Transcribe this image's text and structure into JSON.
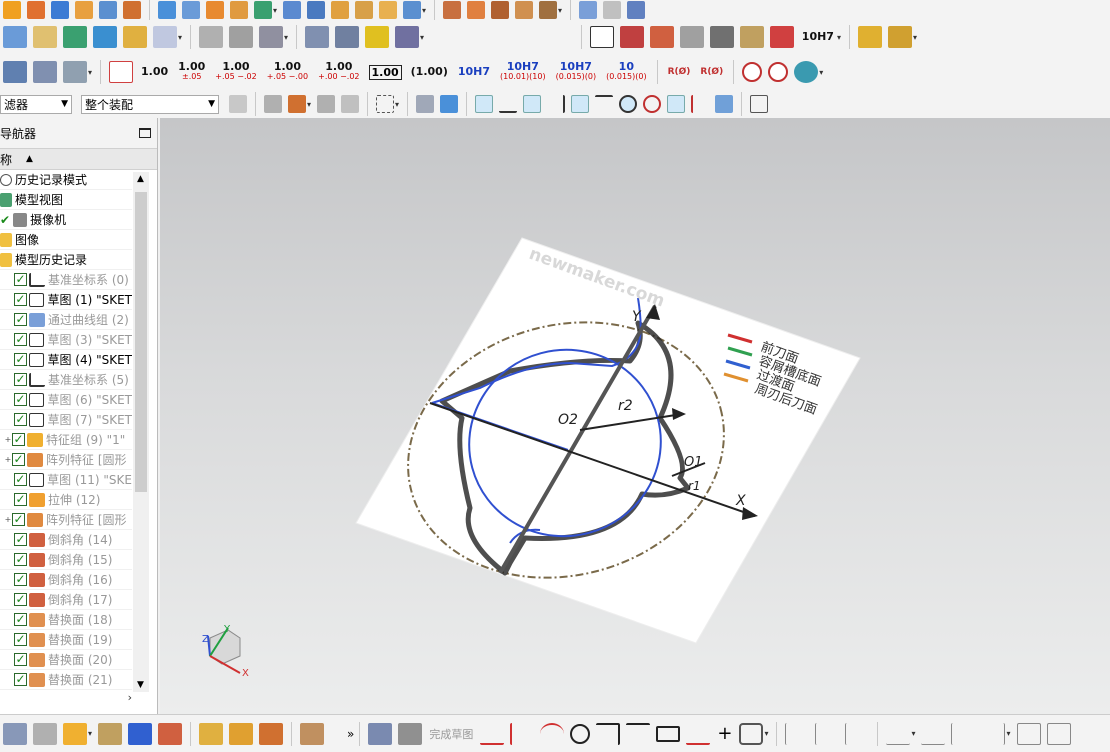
{
  "toolbar": {
    "dims": [
      {
        "main": "1.00",
        "sub": ""
      },
      {
        "main": "1.00",
        "sub": "±.05"
      },
      {
        "main": "1.00",
        "sub": "+.05 −.02"
      },
      {
        "main": "1.00",
        "sub": "+.05 −.00"
      },
      {
        "main": "1.00",
        "sub": "+.00 −.02"
      }
    ],
    "boxed_dim": "1.00",
    "paren_dim": "(1.00)",
    "fits": [
      "10H7",
      "10H7",
      "10H7",
      "10"
    ],
    "fit_subs": [
      "(10.01)(10)",
      "(0.015)(0)",
      "(0.015)(0)"
    ],
    "fit_label": "10H7",
    "radius_labels": [
      "R(Ø)",
      "R(Ø)"
    ]
  },
  "filters": {
    "select_filter": "滤器",
    "assembly_scope": "整个装配"
  },
  "navigator": {
    "title": "导航器",
    "column_name": "称",
    "items": [
      {
        "label": "历史记录模式",
        "grey": false
      },
      {
        "label": "模型视图",
        "grey": false
      },
      {
        "label": "摄像机",
        "grey": false
      },
      {
        "label": "图像",
        "grey": false
      },
      {
        "label": "模型历史记录",
        "grey": false
      },
      {
        "label": "基准坐标系 (0)",
        "grey": true
      },
      {
        "label": "草图 (1) \"SKET",
        "grey": false
      },
      {
        "label": "通过曲线组 (2)",
        "grey": true
      },
      {
        "label": "草图 (3) \"SKET",
        "grey": true
      },
      {
        "label": "草图 (4) \"SKET",
        "grey": false
      },
      {
        "label": "基准坐标系 (5)",
        "grey": true
      },
      {
        "label": "草图 (6) \"SKET",
        "grey": true
      },
      {
        "label": "草图 (7) \"SKET",
        "grey": true
      },
      {
        "label": "特征组 (9) \"1\"",
        "grey": true
      },
      {
        "label": "阵列特征 [圆形",
        "grey": true
      },
      {
        "label": "草图 (11) \"SKE",
        "grey": true
      },
      {
        "label": "拉伸 (12)",
        "grey": true
      },
      {
        "label": "阵列特征 [圆形",
        "grey": true
      },
      {
        "label": "倒斜角 (14)",
        "grey": true
      },
      {
        "label": "倒斜角 (15)",
        "grey": true
      },
      {
        "label": "倒斜角 (16)",
        "grey": true
      },
      {
        "label": "倒斜角 (17)",
        "grey": true
      },
      {
        "label": "替换面 (18)",
        "grey": true
      },
      {
        "label": "替换面 (19)",
        "grey": true
      },
      {
        "label": "替换面 (20)",
        "grey": true
      },
      {
        "label": "替换面 (21)",
        "grey": true
      }
    ]
  },
  "graphics": {
    "watermark": "newmaker.com",
    "legend": [
      "前刀面",
      "容屑槽底面",
      "过渡面",
      "周刃后刀面"
    ],
    "axis_y": "Y",
    "axis_x": "X",
    "o2": "O2",
    "r2": "r2",
    "o1": "O1",
    "r1": "r1",
    "triad_labels": [
      "Z",
      "Y",
      "X"
    ]
  },
  "bottom": {
    "finish_sketch": "完成草图"
  }
}
